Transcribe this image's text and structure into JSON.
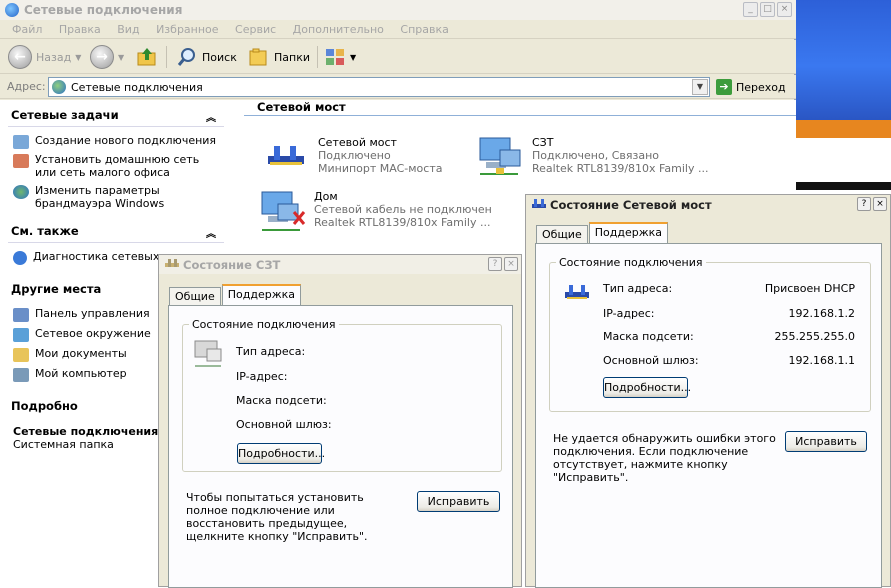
{
  "window": {
    "title": "Сетевые подключения",
    "controls": [
      "_",
      "□",
      "×"
    ]
  },
  "menu": [
    "Файл",
    "Правка",
    "Вид",
    "Избранное",
    "Сервис",
    "Дополнительно",
    "Справка"
  ],
  "toolbar": {
    "back_label": "Назад",
    "search_label": "Поиск",
    "folders_label": "Папки"
  },
  "address": {
    "label": "Адрес:",
    "value": "Сетевые подключения",
    "go_label": "Переход"
  },
  "left_pane": {
    "network_tasks": {
      "title": "Сетевые задачи",
      "items": [
        "Создание нового подключения",
        "Установить домашнюю сеть или сеть малого офиса",
        "Изменить параметры брандмауэра Windows"
      ]
    },
    "see_also": {
      "title": "См. также",
      "items": [
        "Диагностика сетевых не"
      ]
    },
    "other_places": {
      "title": "Другие места",
      "items": [
        "Панель управления",
        "Сетевое окружение",
        "Мои документы",
        "Мой компьютер"
      ]
    },
    "details": {
      "title": "Подробно",
      "name": "Сетевые подключения",
      "type": "Системная папка"
    }
  },
  "content": {
    "group_title": "Сетевой мост",
    "items": [
      {
        "name": "Сетевой мост",
        "status": "Подключено",
        "device": "Минипорт MAC-моста"
      },
      {
        "name": "СЗТ",
        "status": "Подключено, Связано",
        "device": "Realtek RTL8139/810x Family ..."
      },
      {
        "name": "Дом",
        "status": "Сетевой кабель не подключен",
        "device": "Realtek RTL8139/810x Family ..."
      }
    ]
  },
  "dialog_szt": {
    "title": "Состояние СЗТ",
    "tabs": [
      "Общие",
      "Поддержка"
    ],
    "group_title": "Состояние подключения",
    "rows": [
      {
        "label": "Тип адреса:",
        "value": ""
      },
      {
        "label": "IP-адрес:",
        "value": ""
      },
      {
        "label": "Маска подсети:",
        "value": ""
      },
      {
        "label": "Основной шлюз:",
        "value": ""
      }
    ],
    "details_button": "Подробности...",
    "message": "Чтобы попытаться установить полное подключение или восстановить предыдущее, щелкните кнопку \"Исправить\".",
    "repair_button": "Исправить"
  },
  "dialog_bridge": {
    "title": "Состояние Сетевой мост",
    "tabs": [
      "Общие",
      "Поддержка"
    ],
    "group_title": "Состояние подключения",
    "rows": [
      {
        "label": "Тип адреса:",
        "value": "Присвоен DHCP"
      },
      {
        "label": "IP-адрес:",
        "value": "192.168.1.2"
      },
      {
        "label": "Маска подсети:",
        "value": "255.255.255.0"
      },
      {
        "label": "Основной шлюз:",
        "value": "192.168.1.1"
      }
    ],
    "details_button": "Подробности...",
    "message": "Не удается обнаружить ошибки этого подключения. Если подключение отсутствует, нажмите кнопку \"Исправить\".",
    "repair_button": "Исправить"
  }
}
